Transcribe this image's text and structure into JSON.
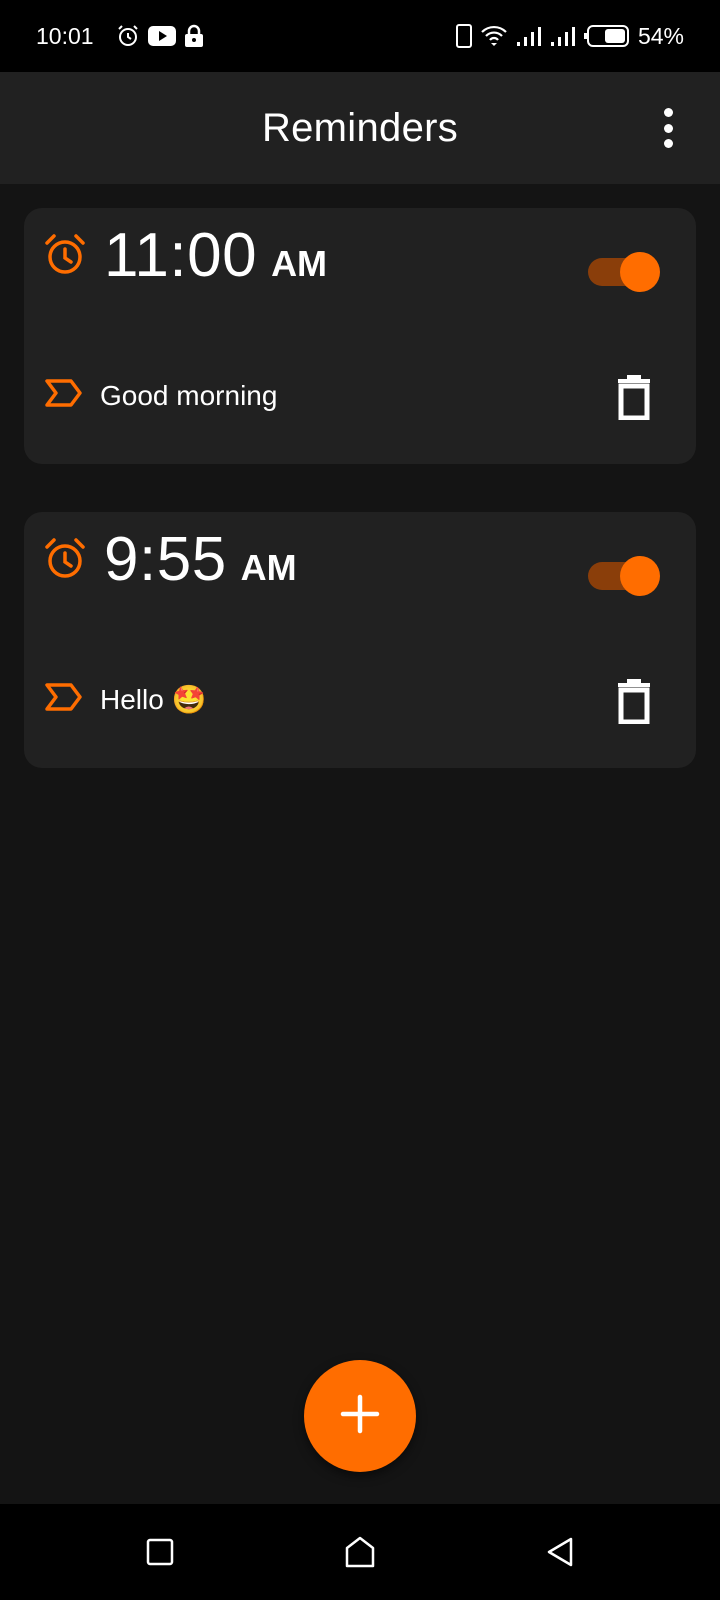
{
  "status_bar": {
    "time": "10:01",
    "battery": "54%",
    "left_icons": [
      "alarm-icon",
      "youtube-icon",
      "lock-icon"
    ],
    "right_icons": [
      "phone-icon",
      "wifi-icon",
      "signal-icon",
      "signal-icon",
      "battery-icon"
    ]
  },
  "app_bar": {
    "title": "Reminders",
    "menu_icon": "more-vert-icon"
  },
  "reminders": [
    {
      "time": "11:00",
      "period": "AM",
      "enabled": true,
      "label": "Good morning"
    },
    {
      "time": "9:55",
      "period": "AM",
      "enabled": true,
      "label": "Hello 🤩"
    }
  ],
  "fab": {
    "icon": "add-icon"
  },
  "nav_bar": {
    "buttons": [
      "recents-button",
      "home-button",
      "back-button"
    ]
  },
  "colors": {
    "accent": "#ff6d00",
    "toggle_track": "#8a3e0a",
    "card_bg": "#212121",
    "page_bg": "#141414",
    "app_bar_bg": "#212121"
  }
}
